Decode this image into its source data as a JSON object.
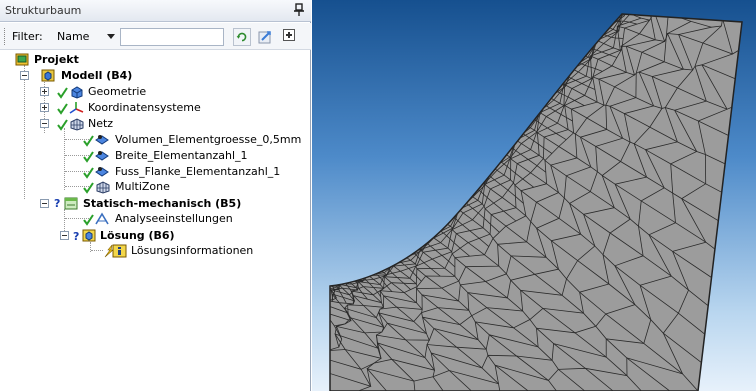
{
  "panel": {
    "title": "Strukturbaum"
  },
  "filter": {
    "label": "Filter:",
    "selected": "Name",
    "value": ""
  },
  "tree": {
    "project": "Projekt",
    "model": "Modell (B4)",
    "geometry": "Geometrie",
    "coordinates": "Koordinatensysteme",
    "mesh": "Netz",
    "mesh_items": [
      "Volumen_Elementgroesse_0,5mm",
      "Breite_Elementanzahl_1",
      "Fuss_Flanke_Elementanzahl_1",
      "MultiZone"
    ],
    "static": "Statisch-mechanisch (B5)",
    "analysis_settings": "Analyseeinstellungen",
    "solution": "Lösung (B6)",
    "solution_info": "Lösungsinformationen"
  },
  "colors": {
    "mesh_fill": "#9c9c9c",
    "mesh_lines": "#2a2a2a",
    "viewport_top": "#16508f",
    "viewport_bottom": "#e7f1fb"
  }
}
